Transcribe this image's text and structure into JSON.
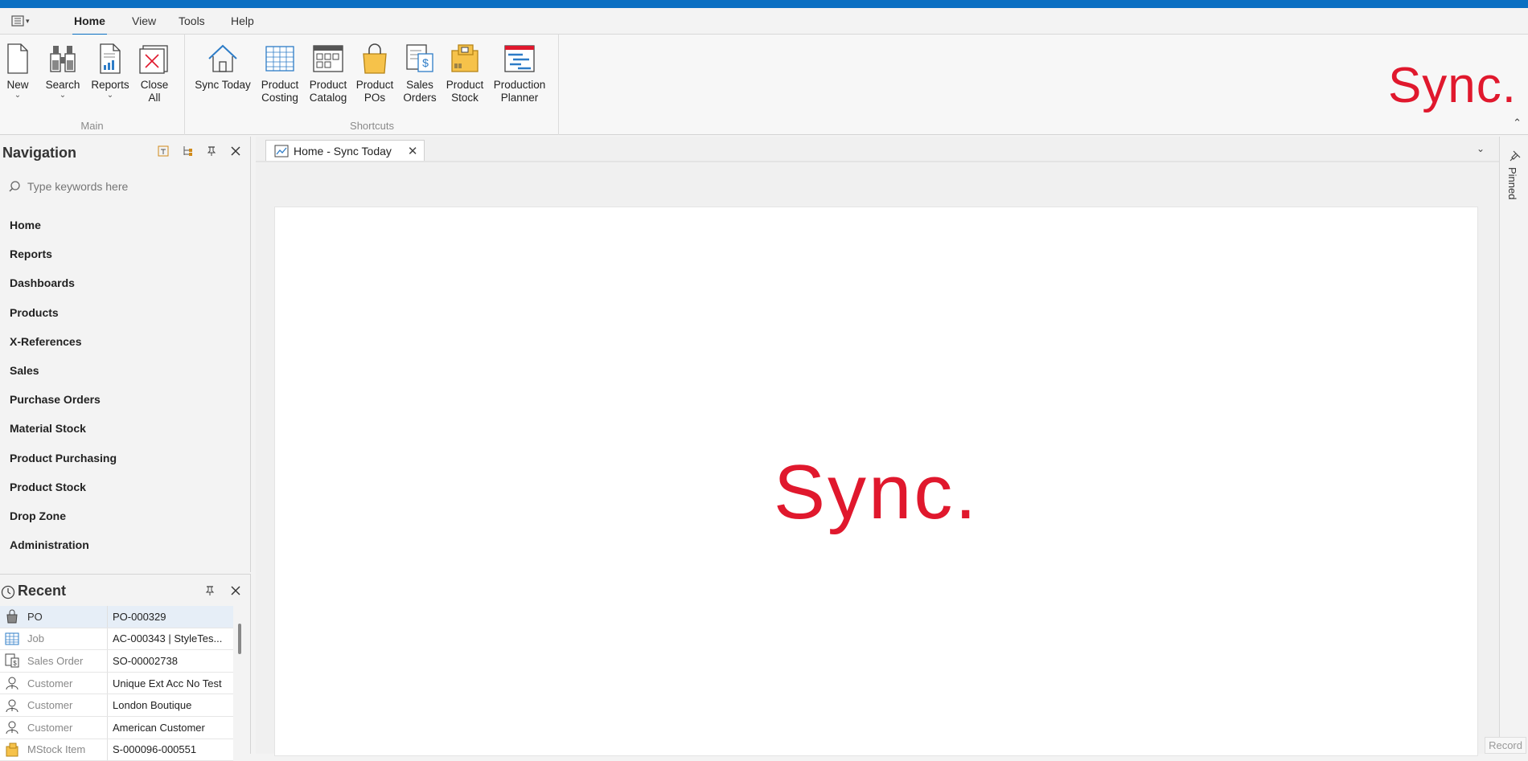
{
  "menubar": {
    "tabs": [
      {
        "label": "Home",
        "active": true
      },
      {
        "label": "View"
      },
      {
        "label": "Tools"
      },
      {
        "label": "Help"
      }
    ]
  },
  "ribbon": {
    "groups": {
      "main": {
        "label": "Main",
        "buttons": {
          "new": {
            "line1": "New",
            "line2": ""
          },
          "search": {
            "line1": "Search",
            "line2": ""
          },
          "reports": {
            "line1": "Reports",
            "line2": ""
          },
          "close_all": {
            "line1": "Close",
            "line2": "All"
          }
        }
      },
      "shortcuts": {
        "label": "Shortcuts",
        "buttons": {
          "sync_today": {
            "line1": "Sync Today",
            "line2": ""
          },
          "product_costing": {
            "line1": "Product",
            "line2": "Costing"
          },
          "product_catalog": {
            "line1": "Product",
            "line2": "Catalog"
          },
          "product_pos": {
            "line1": "Product",
            "line2": "POs"
          },
          "sales_orders": {
            "line1": "Sales",
            "line2": "Orders"
          },
          "product_stock": {
            "line1": "Product",
            "line2": "Stock"
          },
          "production_planner": {
            "line1": "Production",
            "line2": "Planner"
          }
        }
      }
    },
    "brand": "Sync."
  },
  "navigation": {
    "title": "Navigation",
    "search_placeholder": "Type keywords here",
    "items": [
      "Home",
      "Reports",
      "Dashboards",
      "Products",
      "X-References",
      "Sales",
      "Purchase Orders",
      "Material Stock",
      "Product Purchasing",
      "Product Stock",
      "Drop Zone",
      "Administration"
    ]
  },
  "recent": {
    "title": "Recent",
    "rows": [
      {
        "icon": "bag-icon",
        "type": "PO",
        "value": "PO-000329",
        "selected": true
      },
      {
        "icon": "grid-icon",
        "type": "Job",
        "value": "AC-000343 | StyleTes..."
      },
      {
        "icon": "sales-order-icon",
        "type": "Sales Order",
        "value": "SO-00002738"
      },
      {
        "icon": "customer-icon",
        "type": "Customer",
        "value": "Unique Ext Acc No Test"
      },
      {
        "icon": "customer-icon",
        "type": "Customer",
        "value": "London Boutique"
      },
      {
        "icon": "customer-icon",
        "type": "Customer",
        "value": "American Customer"
      },
      {
        "icon": "stock-icon",
        "type": "MStock Item",
        "value": "S-000096-000551"
      }
    ]
  },
  "document": {
    "tab_title": "Home - Sync Today",
    "center_logo": "Sync."
  },
  "side": {
    "pinned_label": "Pinned",
    "record_label": "Record"
  },
  "colors": {
    "accent": "#0a6fc2",
    "brand_red": "#e0182d"
  }
}
